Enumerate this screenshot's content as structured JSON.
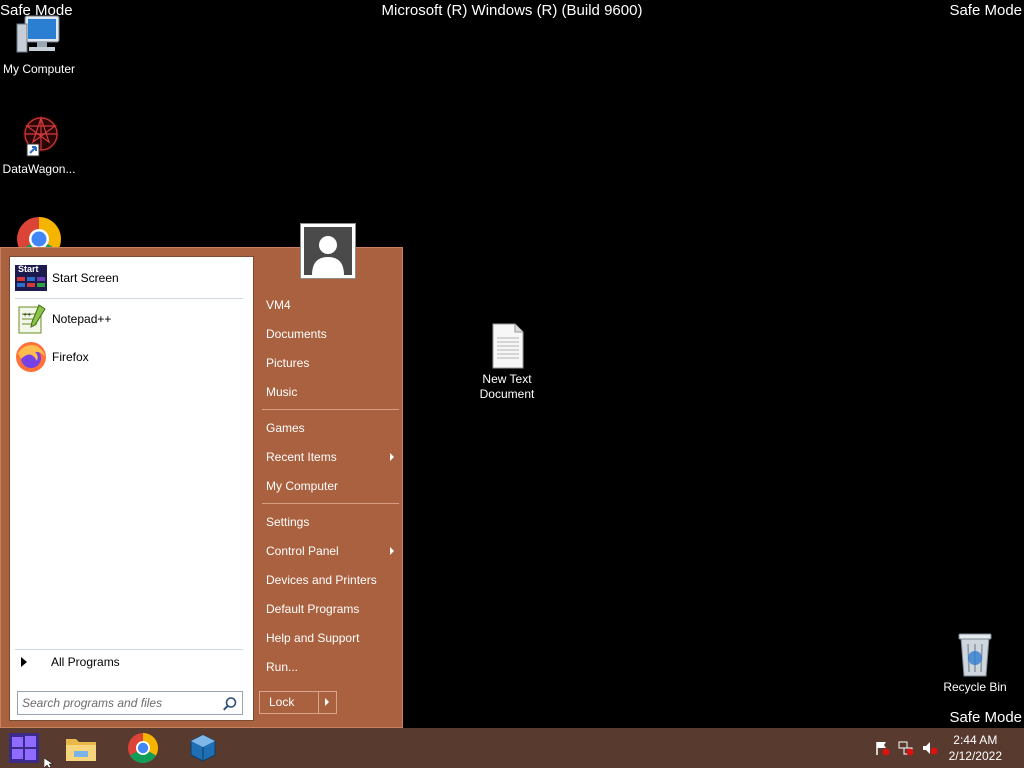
{
  "desktop": {
    "safe_mode_label": "Safe Mode",
    "build_text": "Microsoft (R) Windows (R) (Build 9600)",
    "icons": [
      {
        "label": "My Computer",
        "icon": "computer-icon"
      },
      {
        "label": "DataWagon...",
        "icon": "datawagon-icon"
      },
      {
        "label": "New Text Document",
        "icon": "text-document-icon"
      },
      {
        "label": "Recycle Bin",
        "icon": "recycle-bin-icon"
      }
    ]
  },
  "start_menu": {
    "pinned": [
      {
        "label": "Start Screen",
        "icon": "start-screen-icon"
      },
      {
        "label": "Notepad++",
        "icon": "notepad-plus-plus-icon"
      },
      {
        "label": "Firefox",
        "icon": "firefox-icon"
      }
    ],
    "start_screen_badge": "Start",
    "all_programs_label": "All Programs",
    "search_placeholder": "Search programs and files",
    "right_items": [
      {
        "label": "VM4"
      },
      {
        "label": "Documents"
      },
      {
        "label": "Pictures"
      },
      {
        "label": "Music"
      },
      {
        "label": "Games"
      },
      {
        "label": "Recent Items",
        "submenu": true
      },
      {
        "label": "My Computer"
      },
      {
        "label": "Settings"
      },
      {
        "label": "Control Panel",
        "submenu": true
      },
      {
        "label": "Devices and Printers"
      },
      {
        "label": "Default Programs"
      },
      {
        "label": "Help and Support"
      },
      {
        "label": "Run..."
      }
    ],
    "lock_label": "Lock"
  },
  "taskbar": {
    "buttons": [
      {
        "name": "start-button",
        "icon": "windows-logo-icon"
      },
      {
        "name": "file-explorer-button",
        "icon": "folder-icon"
      },
      {
        "name": "chrome-button",
        "icon": "chrome-icon"
      },
      {
        "name": "virtualbox-button",
        "icon": "virtualbox-icon"
      }
    ],
    "tray_icons": [
      "action-center-flag-icon",
      "network-icon",
      "volume-muted-icon"
    ],
    "time": "2:44 AM",
    "date": "2/12/2022"
  },
  "colors": {
    "start_menu_bg": "#a9613f",
    "taskbar_bg": "#583a2f",
    "desktop_bg": "#000000"
  }
}
